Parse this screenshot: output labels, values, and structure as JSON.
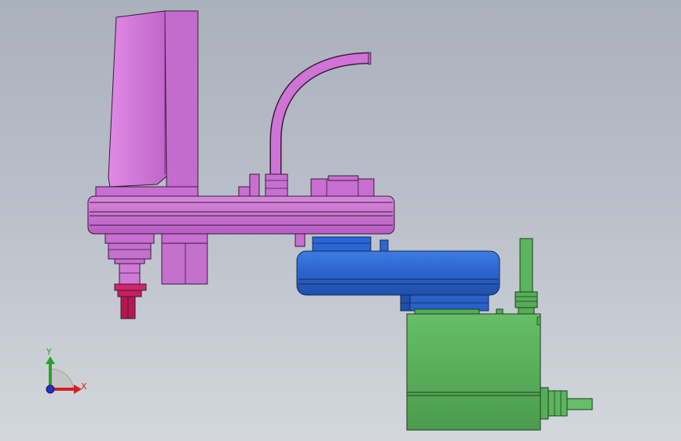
{
  "viewport": {
    "background_top": "#aab1bb",
    "background_bottom": "#d3d7dd"
  },
  "model": {
    "parts": [
      {
        "name": "base-column",
        "color": "#d27ad8"
      },
      {
        "name": "arm-link-1",
        "color": "#c56ad0"
      },
      {
        "name": "cable-conduit",
        "color": "#c96fd6"
      },
      {
        "name": "tool-flange",
        "color": "#c81d5a"
      },
      {
        "name": "arm-link-2",
        "color": "#2c67cf"
      },
      {
        "name": "motor-housing",
        "color": "#56ad58"
      }
    ]
  },
  "triad": {
    "x_label": "X",
    "y_label": "Y",
    "x_color": "#d42020",
    "y_color": "#2aa02a",
    "z_color": "#2030c8"
  }
}
